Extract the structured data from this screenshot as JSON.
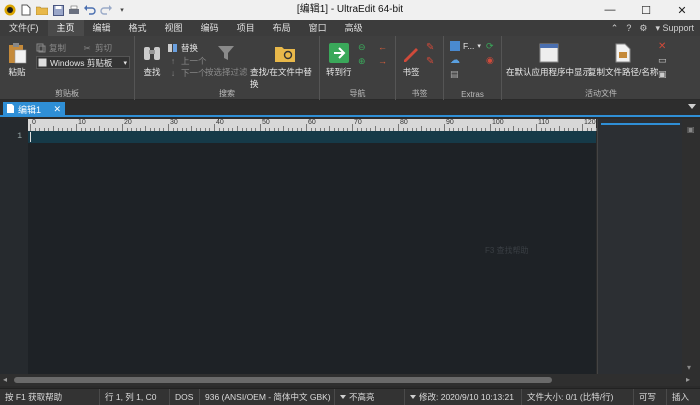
{
  "window": {
    "title": "[编辑1] - UltraEdit 64-bit",
    "minimize_glyph": "—",
    "maximize_glyph": "☐",
    "close_glyph": "✕"
  },
  "menu": {
    "tabs": [
      "文件(F)",
      "主页",
      "编辑",
      "格式",
      "视图",
      "编码",
      "项目",
      "布局",
      "窗口",
      "高级"
    ],
    "active": "主页",
    "support_label": "Support",
    "right_icons": [
      "chevron-up-icon",
      "help-icon",
      "settings-icon"
    ]
  },
  "ribbon": {
    "clipboard": {
      "label": "剪贴板",
      "paste": "粘贴",
      "copy": "复制",
      "cut": "剪切",
      "clipboard_select": "Windows 剪贴板"
    },
    "search": {
      "label": "搜索",
      "find": "查找",
      "replace": "替换",
      "prev": "上一个",
      "next": "下一个",
      "filter": "按选择过滤",
      "find_in_files": "查找/在文件中替换"
    },
    "navigation": {
      "label": "导航",
      "goto": "转到行"
    },
    "bookmarks": {
      "label": "书签",
      "bookmark": "书签"
    },
    "extras": {
      "label": "Extras",
      "ftp": "F..."
    },
    "active_file": {
      "label": "活动文件",
      "open_default": "在默认应用程序中显示",
      "copy_path": "复制文件路径/名称"
    }
  },
  "document": {
    "tab_label": "编辑1",
    "tab_close": "✕",
    "line_number": "1",
    "ruler_numbers": [
      "0",
      "10",
      "20",
      "30",
      "40",
      "50",
      "60",
      "70",
      "80",
      "90",
      "100",
      "110",
      "120"
    ],
    "ghost_text": "F3 查找帮助"
  },
  "status": {
    "help": "按 F1 获取帮助",
    "position": "行 1, 列 1, C0",
    "line_ending": "DOS",
    "codepage": "936  (ANSI/OEM - 简体中文 GBK)",
    "highlight": "不高亮",
    "modified": "修改:  2020/9/10 10:13:21",
    "filesize": "文件大小: 0/1  (比特/行)",
    "writable": "可写",
    "insert": "插入"
  },
  "colors": {
    "accent": "#2f8fd6",
    "editor_bg": "#1e2226",
    "current_line": "#163a48",
    "ribbon_bg": "#3f3f3f"
  }
}
